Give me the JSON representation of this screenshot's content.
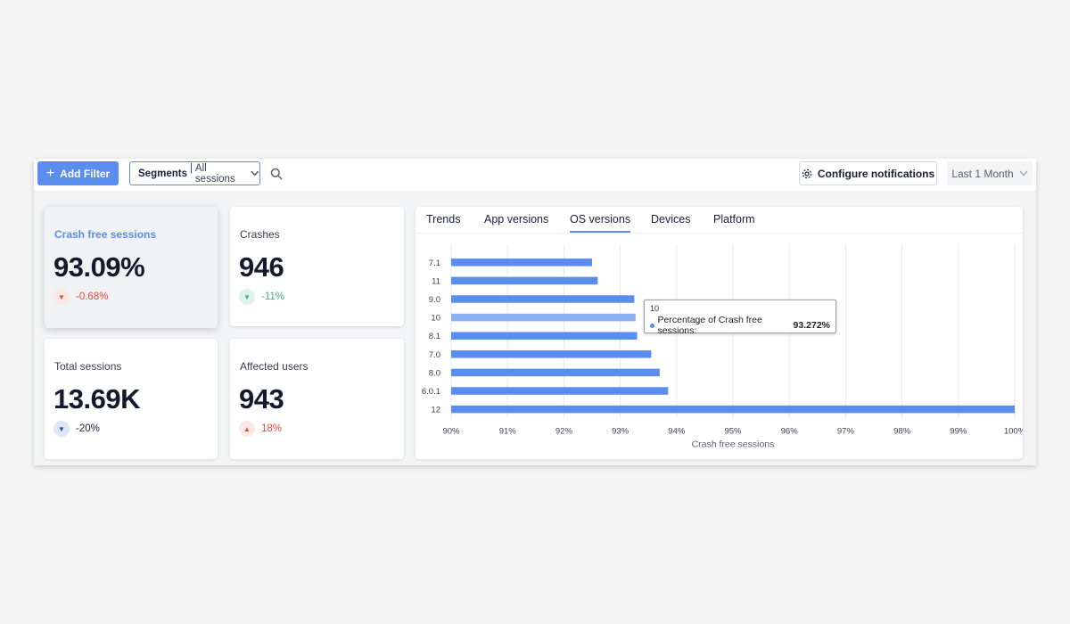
{
  "toolbar": {
    "add_filter_label": "Add Filter",
    "segments_prefix": "Segments",
    "segments_value": "All sessions",
    "notifications_label": "Configure notifications",
    "date_range_label": "Last 1 Month"
  },
  "kpis": [
    {
      "label": "Crash free sessions",
      "value": "93.09%",
      "delta": "-0.68%"
    },
    {
      "label": "Crashes",
      "value": "946",
      "delta": "-11%"
    },
    {
      "label": "Total sessions",
      "value": "13.69K",
      "delta": "-20%"
    },
    {
      "label": "Affected users",
      "value": "943",
      "delta": "18%"
    }
  ],
  "tabs": [
    "Trends",
    "App versions",
    "OS versions",
    "Devices",
    "Platform"
  ],
  "active_tab": "OS versions",
  "tooltip": {
    "title": "10",
    "label": "Percentage of Crash free sessions:",
    "value": "93.272%"
  },
  "colors": {
    "accent": "#5b8def",
    "bar": "#5b8def",
    "bar_highlight": "#8db0f4",
    "negative": "#e5483e",
    "positive": "#3fb07c"
  },
  "chart_data": {
    "type": "bar",
    "orientation": "horizontal",
    "categories": [
      "7.1",
      "11",
      "9.0",
      "10",
      "8.1",
      "7.0",
      "8.0",
      "6.0.1",
      "12"
    ],
    "values": [
      92.5,
      92.6,
      93.25,
      93.272,
      93.3,
      93.55,
      93.7,
      93.85,
      100
    ],
    "xlabel": "Crash free sessions",
    "ylabel": "",
    "xlim": [
      90,
      100
    ],
    "xticks": [
      "90%",
      "91%",
      "92%",
      "93%",
      "94%",
      "95%",
      "96%",
      "97%",
      "98%",
      "99%",
      "100%"
    ],
    "grid": true,
    "highlighted_category": "10"
  }
}
